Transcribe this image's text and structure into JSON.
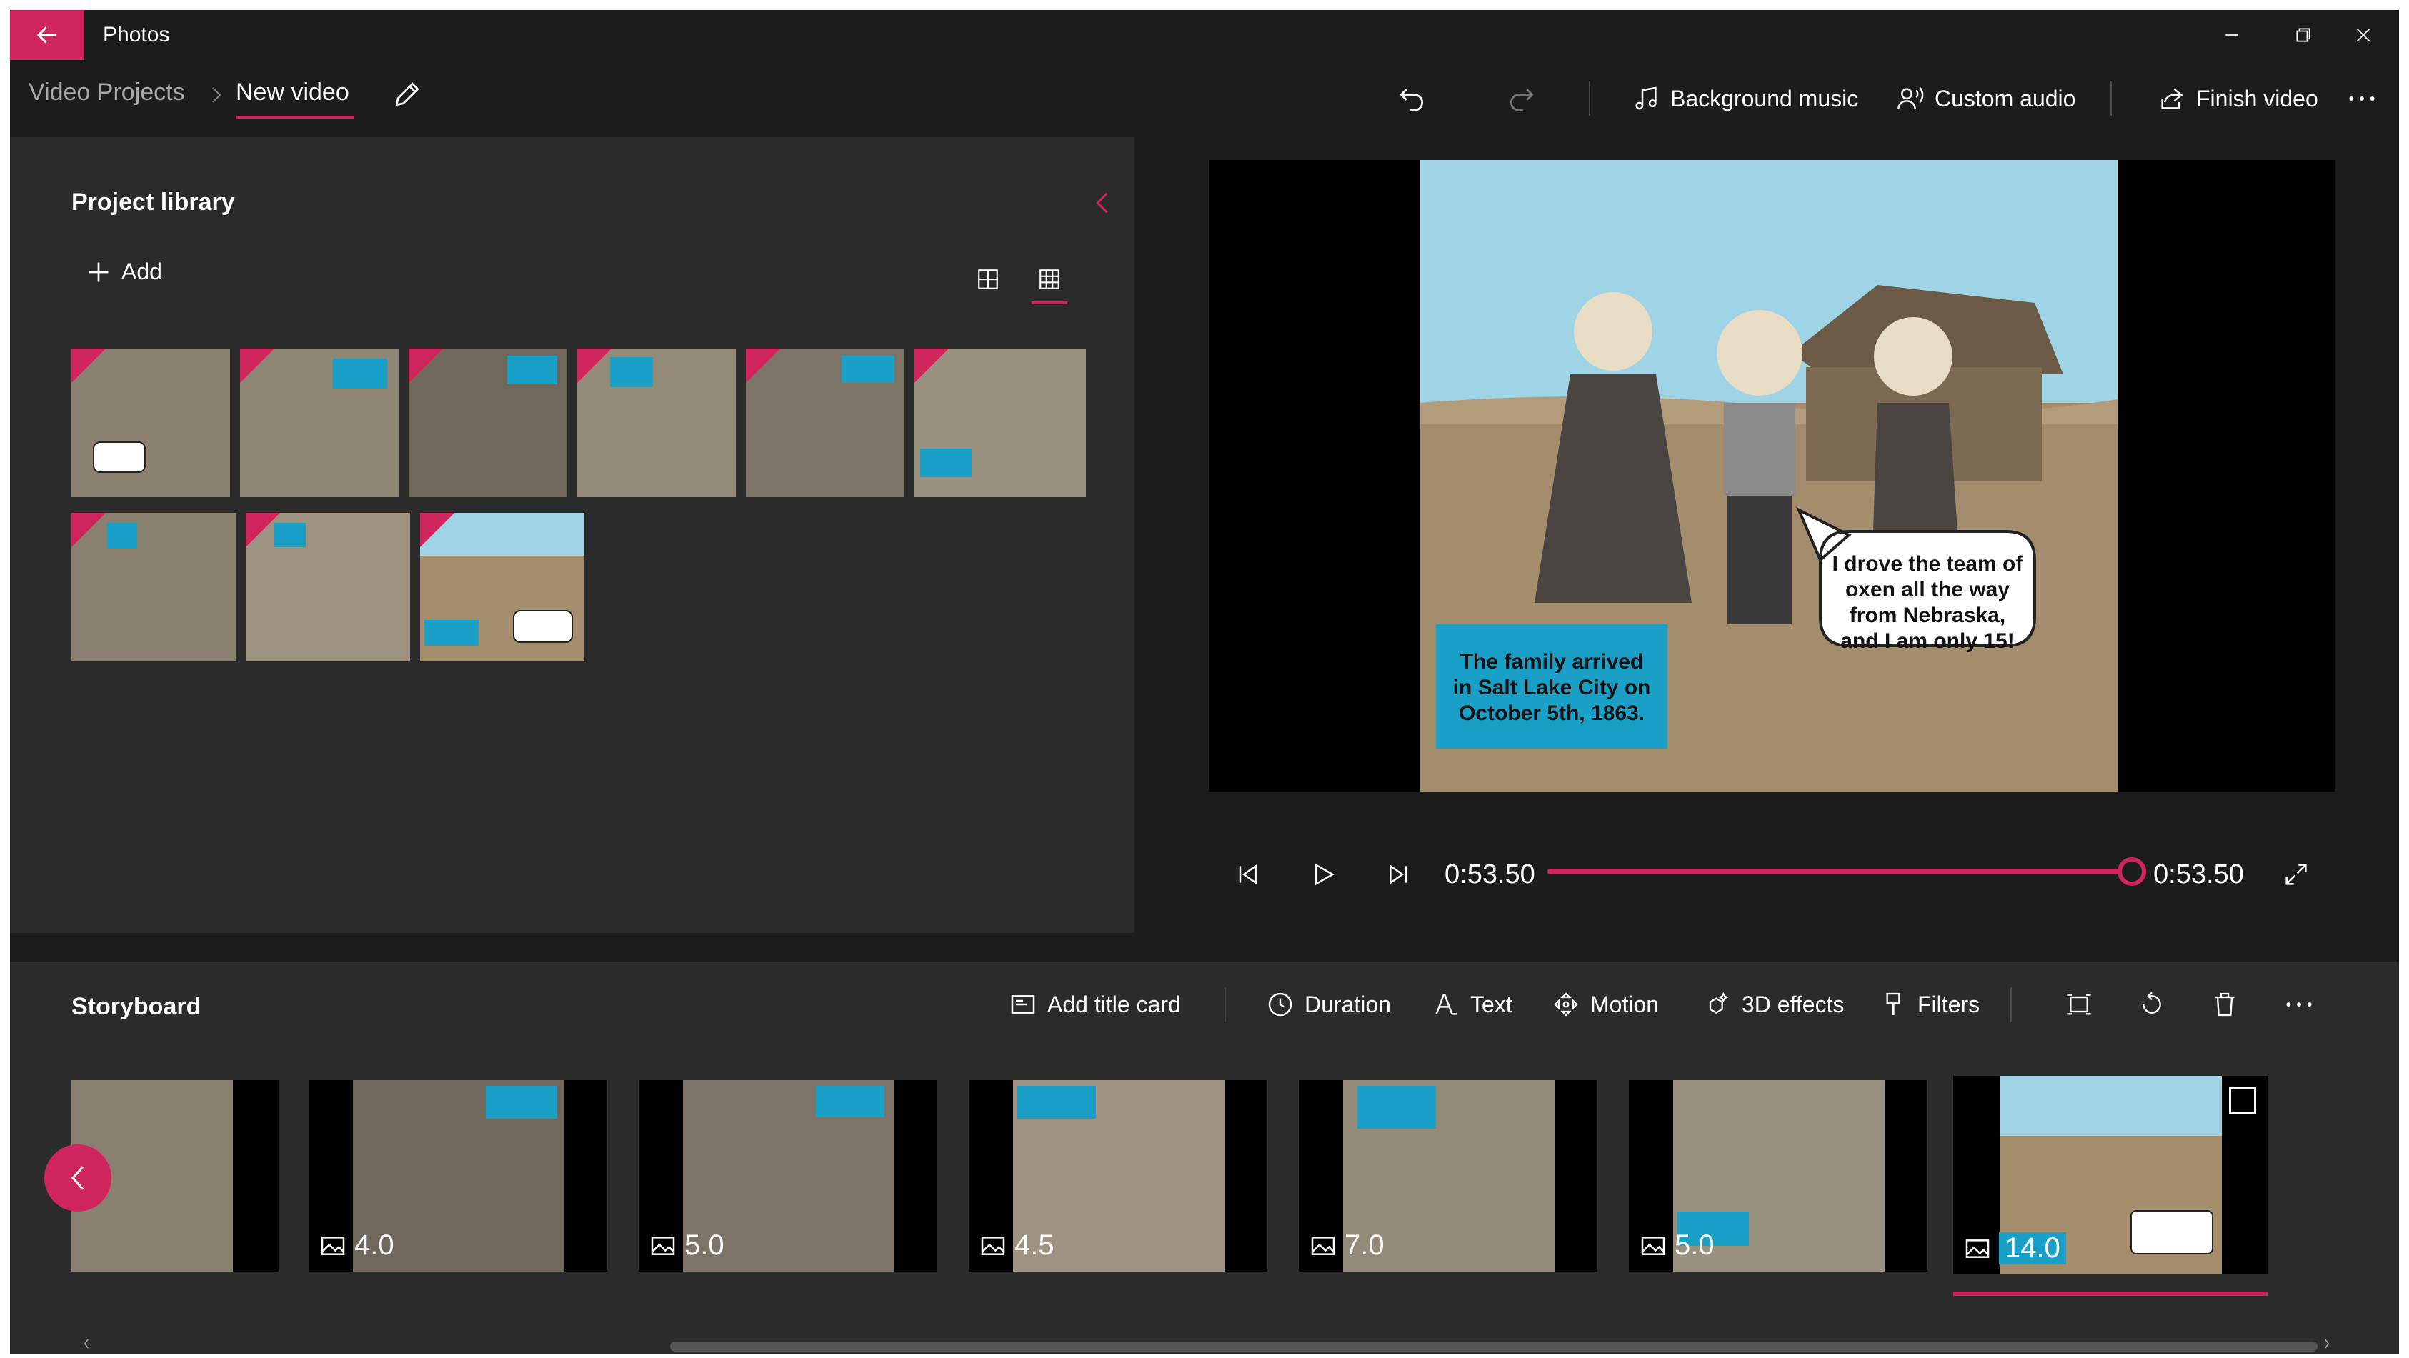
{
  "app": {
    "title": "Photos"
  },
  "breadcrumb": {
    "root": "Video Projects",
    "current": "New video"
  },
  "toolbar": {
    "background_music": "Background music",
    "custom_audio": "Custom audio",
    "finish_video": "Finish video"
  },
  "library": {
    "title": "Project library",
    "add_label": "Add"
  },
  "preview": {
    "caption": "The family arrived in Salt Lake City on October 5th, 1863.",
    "speech": "I drove the team of oxen all the way from Nebraska, and I am only 15!",
    "current_time": "0:53.50",
    "total_time": "0:53.50",
    "progress": 1.0
  },
  "storyboard": {
    "title": "Storyboard",
    "add_title_card": "Add title card",
    "duration": "Duration",
    "text": "Text",
    "motion": "Motion",
    "effects_3d": "3D effects",
    "filters": "Filters",
    "clips": [
      {
        "duration": ""
      },
      {
        "duration": "4.0"
      },
      {
        "duration": "5.0"
      },
      {
        "duration": "4.5"
      },
      {
        "duration": "7.0"
      },
      {
        "duration": "5.0"
      },
      {
        "duration": "14.0"
      }
    ]
  },
  "colors": {
    "accent": "#d0245d",
    "caption_blue": "#1aa0c7",
    "sepia": "#8c8272",
    "sky": "#9fd3e6",
    "ground": "#a48d6c"
  }
}
